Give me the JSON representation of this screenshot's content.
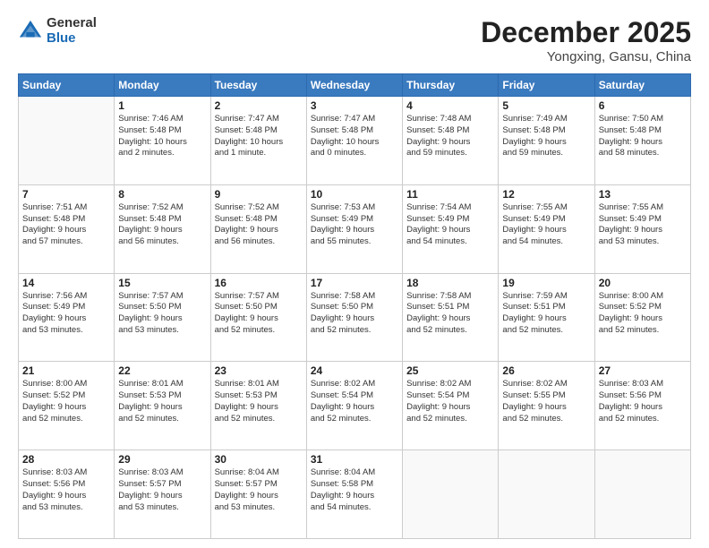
{
  "logo": {
    "general": "General",
    "blue": "Blue"
  },
  "title": {
    "month": "December 2025",
    "location": "Yongxing, Gansu, China"
  },
  "weekdays": [
    "Sunday",
    "Monday",
    "Tuesday",
    "Wednesday",
    "Thursday",
    "Friday",
    "Saturday"
  ],
  "weeks": [
    [
      {
        "day": "",
        "info": ""
      },
      {
        "day": "1",
        "info": "Sunrise: 7:46 AM\nSunset: 5:48 PM\nDaylight: 10 hours\nand 2 minutes."
      },
      {
        "day": "2",
        "info": "Sunrise: 7:47 AM\nSunset: 5:48 PM\nDaylight: 10 hours\nand 1 minute."
      },
      {
        "day": "3",
        "info": "Sunrise: 7:47 AM\nSunset: 5:48 PM\nDaylight: 10 hours\nand 0 minutes."
      },
      {
        "day": "4",
        "info": "Sunrise: 7:48 AM\nSunset: 5:48 PM\nDaylight: 9 hours\nand 59 minutes."
      },
      {
        "day": "5",
        "info": "Sunrise: 7:49 AM\nSunset: 5:48 PM\nDaylight: 9 hours\nand 59 minutes."
      },
      {
        "day": "6",
        "info": "Sunrise: 7:50 AM\nSunset: 5:48 PM\nDaylight: 9 hours\nand 58 minutes."
      }
    ],
    [
      {
        "day": "7",
        "info": "Sunrise: 7:51 AM\nSunset: 5:48 PM\nDaylight: 9 hours\nand 57 minutes."
      },
      {
        "day": "8",
        "info": "Sunrise: 7:52 AM\nSunset: 5:48 PM\nDaylight: 9 hours\nand 56 minutes."
      },
      {
        "day": "9",
        "info": "Sunrise: 7:52 AM\nSunset: 5:48 PM\nDaylight: 9 hours\nand 56 minutes."
      },
      {
        "day": "10",
        "info": "Sunrise: 7:53 AM\nSunset: 5:49 PM\nDaylight: 9 hours\nand 55 minutes."
      },
      {
        "day": "11",
        "info": "Sunrise: 7:54 AM\nSunset: 5:49 PM\nDaylight: 9 hours\nand 54 minutes."
      },
      {
        "day": "12",
        "info": "Sunrise: 7:55 AM\nSunset: 5:49 PM\nDaylight: 9 hours\nand 54 minutes."
      },
      {
        "day": "13",
        "info": "Sunrise: 7:55 AM\nSunset: 5:49 PM\nDaylight: 9 hours\nand 53 minutes."
      }
    ],
    [
      {
        "day": "14",
        "info": "Sunrise: 7:56 AM\nSunset: 5:49 PM\nDaylight: 9 hours\nand 53 minutes."
      },
      {
        "day": "15",
        "info": "Sunrise: 7:57 AM\nSunset: 5:50 PM\nDaylight: 9 hours\nand 53 minutes."
      },
      {
        "day": "16",
        "info": "Sunrise: 7:57 AM\nSunset: 5:50 PM\nDaylight: 9 hours\nand 52 minutes."
      },
      {
        "day": "17",
        "info": "Sunrise: 7:58 AM\nSunset: 5:50 PM\nDaylight: 9 hours\nand 52 minutes."
      },
      {
        "day": "18",
        "info": "Sunrise: 7:58 AM\nSunset: 5:51 PM\nDaylight: 9 hours\nand 52 minutes."
      },
      {
        "day": "19",
        "info": "Sunrise: 7:59 AM\nSunset: 5:51 PM\nDaylight: 9 hours\nand 52 minutes."
      },
      {
        "day": "20",
        "info": "Sunrise: 8:00 AM\nSunset: 5:52 PM\nDaylight: 9 hours\nand 52 minutes."
      }
    ],
    [
      {
        "day": "21",
        "info": "Sunrise: 8:00 AM\nSunset: 5:52 PM\nDaylight: 9 hours\nand 52 minutes."
      },
      {
        "day": "22",
        "info": "Sunrise: 8:01 AM\nSunset: 5:53 PM\nDaylight: 9 hours\nand 52 minutes."
      },
      {
        "day": "23",
        "info": "Sunrise: 8:01 AM\nSunset: 5:53 PM\nDaylight: 9 hours\nand 52 minutes."
      },
      {
        "day": "24",
        "info": "Sunrise: 8:02 AM\nSunset: 5:54 PM\nDaylight: 9 hours\nand 52 minutes."
      },
      {
        "day": "25",
        "info": "Sunrise: 8:02 AM\nSunset: 5:54 PM\nDaylight: 9 hours\nand 52 minutes."
      },
      {
        "day": "26",
        "info": "Sunrise: 8:02 AM\nSunset: 5:55 PM\nDaylight: 9 hours\nand 52 minutes."
      },
      {
        "day": "27",
        "info": "Sunrise: 8:03 AM\nSunset: 5:56 PM\nDaylight: 9 hours\nand 52 minutes."
      }
    ],
    [
      {
        "day": "28",
        "info": "Sunrise: 8:03 AM\nSunset: 5:56 PM\nDaylight: 9 hours\nand 53 minutes."
      },
      {
        "day": "29",
        "info": "Sunrise: 8:03 AM\nSunset: 5:57 PM\nDaylight: 9 hours\nand 53 minutes."
      },
      {
        "day": "30",
        "info": "Sunrise: 8:04 AM\nSunset: 5:57 PM\nDaylight: 9 hours\nand 53 minutes."
      },
      {
        "day": "31",
        "info": "Sunrise: 8:04 AM\nSunset: 5:58 PM\nDaylight: 9 hours\nand 54 minutes."
      },
      {
        "day": "",
        "info": ""
      },
      {
        "day": "",
        "info": ""
      },
      {
        "day": "",
        "info": ""
      }
    ]
  ]
}
